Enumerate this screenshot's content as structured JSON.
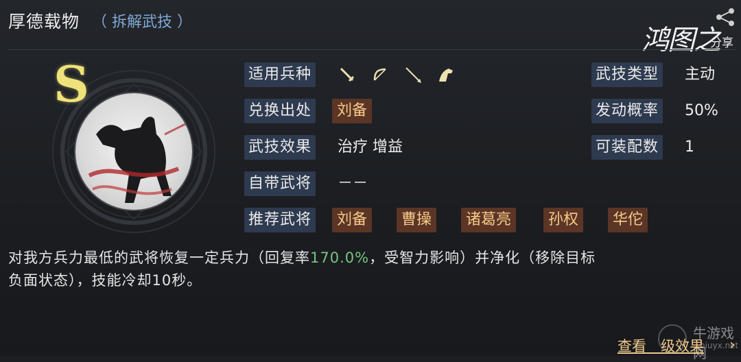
{
  "header": {
    "title": "厚德载物",
    "link": "（ 拆解武技 ）"
  },
  "brand": {
    "logo": "鸿图之",
    "share": "分享"
  },
  "skill": {
    "grade": "S",
    "fields": {
      "troop_label": "适用兵种",
      "source_label": "兑换出处",
      "effect_label": "武技效果",
      "own_general_label": "自带武将",
      "recommend_label": "推荐武将",
      "type_label": "武技类型",
      "trigger_label": "发动概率",
      "equip_label": "可装配数"
    },
    "troop_icons": [
      "sword-icon",
      "bow-icon",
      "spear-icon",
      "horse-icon"
    ],
    "source": "刘备",
    "effect": "治疗  增益",
    "own_general": "－－",
    "recommended": [
      "刘备",
      "曹操",
      "诸葛亮",
      "孙权",
      "华佗"
    ],
    "type": "主动",
    "trigger_rate": "50%",
    "equip_count": "1"
  },
  "description": {
    "part1": "对我方兵力最低的武将恢复一定兵力（回复率",
    "highlight": "170.0%",
    "part2": "，受智力影响）并净化（移除目标",
    "line2": "负面状态），技能冷却10秒。"
  },
  "footer": {
    "link": "查看",
    "link_rest": "级效果"
  },
  "watermark": {
    "text": "牛游戏网",
    "url": "niuyx.net"
  },
  "colors": {
    "label_bg": "#2e3a4f",
    "tag_bg": "#5b3526",
    "tag_text": "#f6c987",
    "highlight": "#78c481",
    "link": "#7fa9d6",
    "grade": "#f0e27a"
  }
}
